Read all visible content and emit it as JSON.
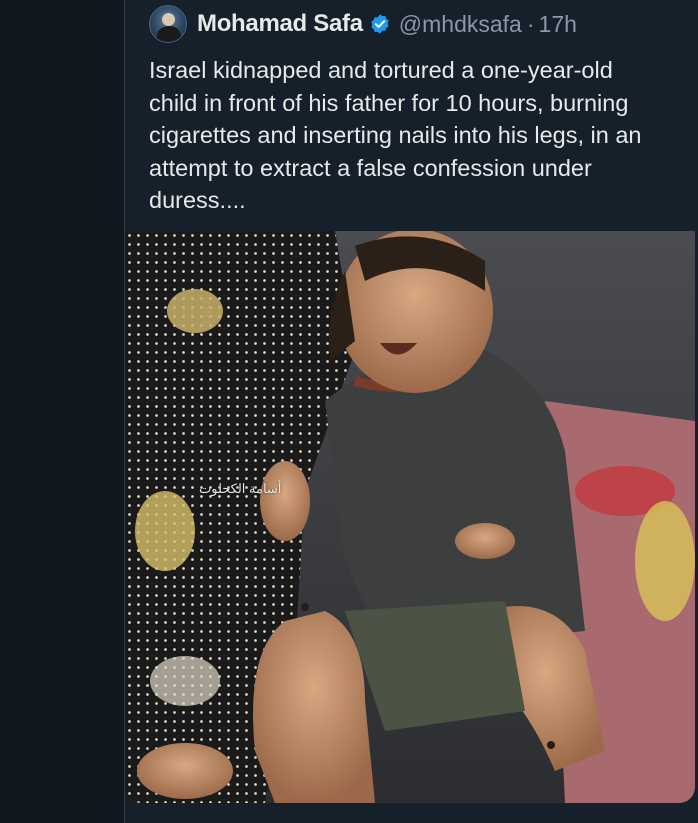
{
  "tweet": {
    "author_name": "Mohamad Safa",
    "handle": "@mhdksafa",
    "separator": "·",
    "time": "17h",
    "text": "Israel kidnapped and tortured a one-year-old\nchild in front of his father for 10 hours, burning\ncigarettes and inserting nails into his legs, in an\nattempt to extract a false confession under\nduress....",
    "icons": {
      "avatar": "profile-avatar",
      "verified": "verified-badge-icon"
    },
    "media": {
      "watermark": "أسامة الكحلوت"
    }
  },
  "colors": {
    "background": "#15202b",
    "text": "#e7e9ea",
    "secondary_text": "#8b98a5",
    "verified_blue": "#1d9bf0"
  }
}
